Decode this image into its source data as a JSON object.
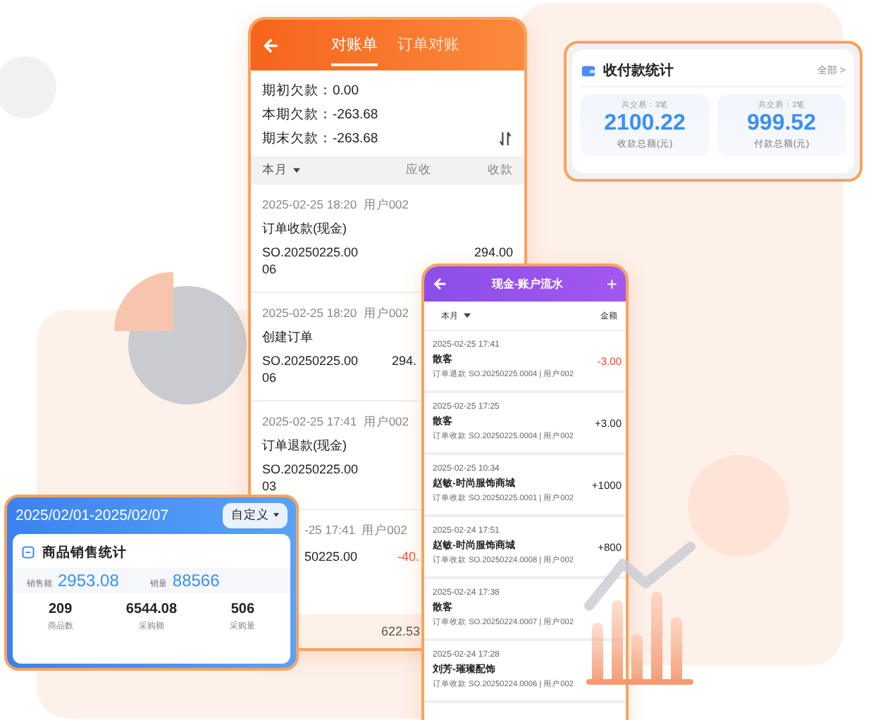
{
  "statement": {
    "tabs": [
      {
        "label": "对账单",
        "selected": true
      },
      {
        "label": "订单对账",
        "selected": false
      }
    ],
    "summary": [
      {
        "label": "期初欠款：",
        "value": "0.00"
      },
      {
        "label": "本期欠款：",
        "value": "-263.68"
      },
      {
        "label": "期末欠款：",
        "value": "-263.68"
      }
    ],
    "filter": "本月",
    "columns": [
      "应收",
      "收款"
    ],
    "entries": [
      {
        "time": "2025-02-25 18:20",
        "user": "用户002",
        "title": "订单收款(现金)",
        "order": "SO.20250225.00",
        "order_tail": "06",
        "received": "294.00"
      },
      {
        "time": "2025-02-25 18:20",
        "user": "用户002",
        "title": "创建订单",
        "order": "SO.20250225.00",
        "order_tail": "06",
        "receivable": "294."
      },
      {
        "time": "2025-02-25 17:41",
        "user": "用户002",
        "title": "订单退款(现金)",
        "order": "SO.20250225.00",
        "order_tail": "03"
      },
      {
        "time": "-25 17:41",
        "user": "用户002",
        "order": "50225.00",
        "receivable": "-40."
      }
    ],
    "total": "622.53"
  },
  "payments": {
    "title": "收付款统计",
    "link": "全部 >",
    "tiles": [
      {
        "caption": "共交易：3笔",
        "value": "2100.22",
        "label": "收款总额(元)"
      },
      {
        "caption": "共交易：3笔",
        "value": "999.52",
        "label": "付款总额(元)"
      }
    ]
  },
  "cashflow": {
    "title": "现金-账户流水",
    "add": "+",
    "filter": "本月",
    "column": "金额",
    "rows": [
      {
        "time": "2025-02-25 17:41",
        "name": "散客",
        "detail": "订单退款 SO.20250225.0004 | 用户002",
        "amount": "-3.00",
        "negative": true
      },
      {
        "time": "2025-02-25 17:25",
        "name": "散客",
        "detail": "订单收款 SO.20250225.0004 | 用户002",
        "amount": "+3.00",
        "negative": false
      },
      {
        "time": "2025-02-25 10:34",
        "name": "赵敏-时尚服饰商城",
        "detail": "订单收款 SO.20250225.0001 | 用户002",
        "amount": "+1000",
        "negative": false
      },
      {
        "time": "2025-02-24 17:51",
        "name": "赵敏-时尚服饰商城",
        "detail": "订单收款 SO.20250224.0008 | 用户002",
        "amount": "+800",
        "negative": false
      },
      {
        "time": "2025-02-24 17:38",
        "name": "散客",
        "detail": "订单收款 SO.20250224.0007 | 用户002"
      },
      {
        "time": "2025-02-24 17:28",
        "name": "刘芳-璀璨配饰",
        "detail": "订单收款 SO.20250224.0006 | 用户002"
      }
    ]
  },
  "sales": {
    "range": "2025/02/01-2025/02/07",
    "button": "自定义",
    "title": "商品销售统计",
    "highlights": [
      {
        "label": "销售额",
        "value": "2953.08"
      },
      {
        "label": "销量",
        "value": "88566"
      }
    ],
    "stats": [
      {
        "value": "209",
        "label": "商品数"
      },
      {
        "value": "6544.08",
        "label": "采购额"
      },
      {
        "value": "506",
        "label": "采购量"
      }
    ]
  }
}
